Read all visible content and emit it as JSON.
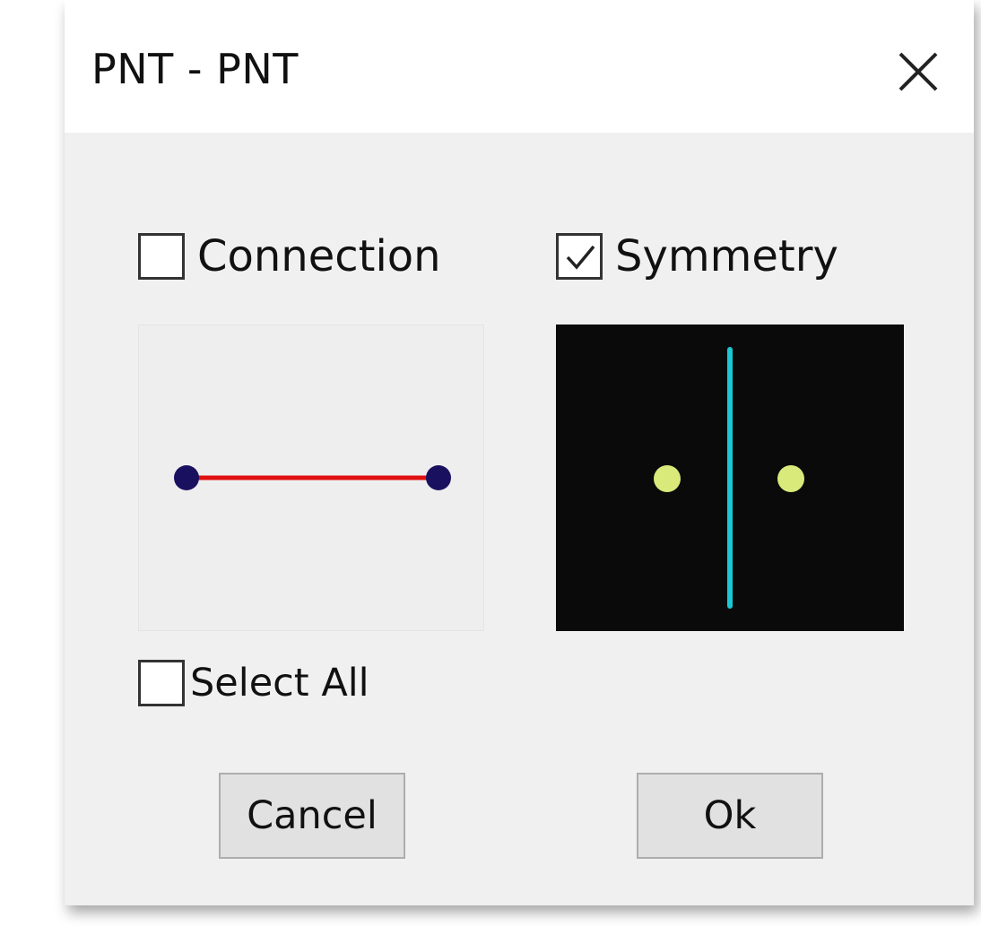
{
  "window": {
    "title": "PNT - PNT",
    "close_icon": "close-icon"
  },
  "options": {
    "connection": {
      "label": "Connection",
      "checked": false
    },
    "symmetry": {
      "label": "Symmetry",
      "checked": true
    },
    "select_all": {
      "label": "Select All",
      "checked": false
    }
  },
  "previews": {
    "connection": {
      "background": "#eeeeee",
      "line_color": "#e01010",
      "point_color": "#1a1060"
    },
    "symmetry": {
      "background": "#0a0a0a",
      "axis_color": "#19c8d2",
      "point_color": "#d9ea7a"
    }
  },
  "buttons": {
    "cancel": "Cancel",
    "ok": "Ok"
  }
}
